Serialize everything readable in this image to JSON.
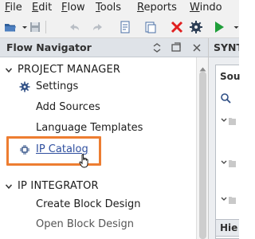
{
  "menu": {
    "items": [
      "File",
      "Edit",
      "Flow",
      "Tools",
      "Reports",
      "Windo"
    ]
  },
  "toolbar": {
    "icons": [
      "open-project-icon",
      "save-icon",
      "undo-icon",
      "redo-icon",
      "copy-icon",
      "paste-icon",
      "delete-icon",
      "settings-icon",
      "run-icon"
    ]
  },
  "flow_navigator": {
    "title": "Flow Navigator",
    "sections": [
      {
        "label": "PROJECT MANAGER",
        "items": [
          {
            "label": "Settings",
            "icon": "gear-icon"
          },
          {
            "label": "Add Sources"
          },
          {
            "label": "Language Templates"
          },
          {
            "label": "IP Catalog",
            "icon": "ip-chip-icon",
            "highlighted": true
          }
        ]
      },
      {
        "label": "IP INTEGRATOR",
        "items": [
          {
            "label": "Create Block Design"
          },
          {
            "label": "Open Block Design"
          }
        ]
      }
    ]
  },
  "right_panel": {
    "tab_label": "SYNT",
    "box_title": "Sou",
    "bottom_label": "Hie"
  },
  "colors": {
    "highlight": "#ed7d31",
    "link": "#2f4f9f",
    "panel_header": "#dfe3e8"
  }
}
